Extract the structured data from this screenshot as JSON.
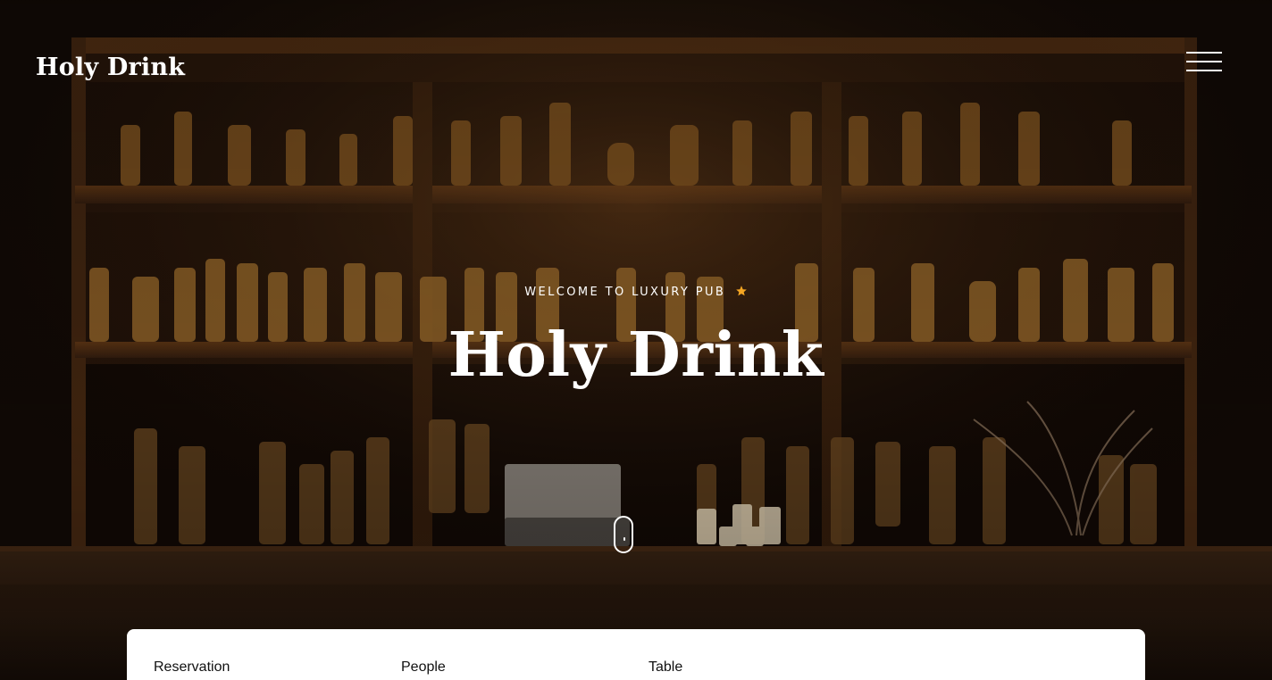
{
  "header": {
    "logo_text": "Holy Drink",
    "menu_icon": "hamburger-menu-icon"
  },
  "hero": {
    "tagline": "WELCOME TO LUXURY PUB",
    "tagline_icon": "star-icon",
    "title": "Holy Drink",
    "scroll_icon": "mouse-scroll-icon"
  },
  "reservation_bar": {
    "fields": [
      {
        "label": "Reservation"
      },
      {
        "label": "People"
      },
      {
        "label": "Table"
      }
    ]
  },
  "colors": {
    "accent": "#f5a623",
    "text": "#ffffff",
    "background": "#140c07",
    "card": "#ffffff"
  }
}
